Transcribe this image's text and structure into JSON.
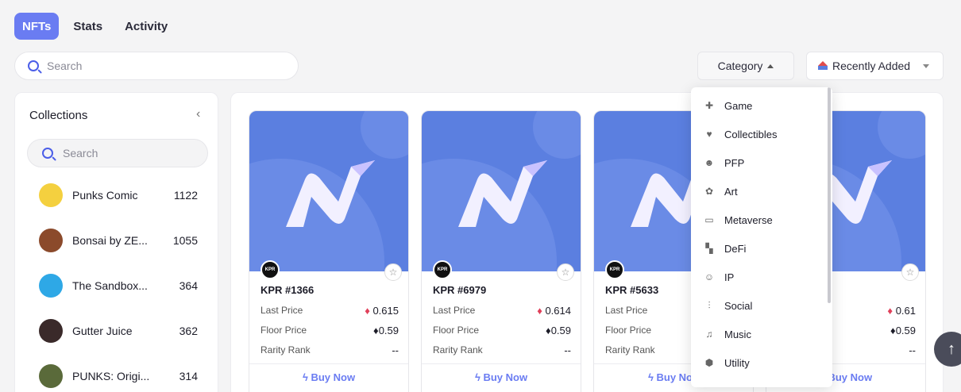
{
  "tabs": [
    {
      "label": "NFTs",
      "active": true
    },
    {
      "label": "Stats",
      "active": false
    },
    {
      "label": "Activity",
      "active": false
    }
  ],
  "search": {
    "placeholder": "Search"
  },
  "category_button": {
    "label": "Category"
  },
  "sort_button": {
    "label": "Recently Added"
  },
  "collections": {
    "title": "Collections",
    "search_placeholder": "Search",
    "items": [
      {
        "name": "Punks Comic",
        "count": "1122",
        "color": "#f4d03f"
      },
      {
        "name": "Bonsai by ZE...",
        "count": "1055",
        "color": "#8b4a2b"
      },
      {
        "name": "The Sandbox...",
        "count": "364",
        "color": "#2ea8e6"
      },
      {
        "name": "Gutter Juice",
        "count": "362",
        "color": "#3a2a2a"
      },
      {
        "name": "PUNKS: Origi...",
        "count": "314",
        "color": "#5a6a3a"
      }
    ]
  },
  "cards": [
    {
      "title": "KPR #1366",
      "last_price_label": "Last Price",
      "last_price": "0.615",
      "floor_price_label": "Floor Price",
      "floor_price": "0.59",
      "rarity_label": "Rarity Rank",
      "rarity": "--",
      "buy_label": "Buy Now",
      "badge": "KPR"
    },
    {
      "title": "KPR #6979",
      "last_price_label": "Last Price",
      "last_price": "0.614",
      "floor_price_label": "Floor Price",
      "floor_price": "0.59",
      "rarity_label": "Rarity Rank",
      "rarity": "--",
      "buy_label": "Buy Now",
      "badge": "KPR"
    },
    {
      "title": "KPR #5633",
      "last_price_label": "Last Price",
      "last_price": "",
      "floor_price_label": "Floor Price",
      "floor_price": "",
      "rarity_label": "Rarity Rank",
      "rarity": "",
      "buy_label": "Buy No",
      "badge": "KPR"
    },
    {
      "title": "",
      "last_price_label": "",
      "last_price": "0.61",
      "floor_price_label": "",
      "floor_price": "0.59",
      "rarity_label": "",
      "rarity": "--",
      "buy_label": "Buy Now",
      "badge": ""
    }
  ],
  "category_menu": [
    {
      "label": "Game",
      "icon": "game-icon",
      "glyph": "✚"
    },
    {
      "label": "Collectibles",
      "icon": "heart-icon",
      "glyph": "♥"
    },
    {
      "label": "PFP",
      "icon": "robot-icon",
      "glyph": "☻"
    },
    {
      "label": "Art",
      "icon": "palette-icon",
      "glyph": "✿"
    },
    {
      "label": "Metaverse",
      "icon": "vr-headset-icon",
      "glyph": "▭"
    },
    {
      "label": "DeFi",
      "icon": "defi-icon",
      "glyph": "▚"
    },
    {
      "label": "IP",
      "icon": "face-icon",
      "glyph": "☺"
    },
    {
      "label": "Social",
      "icon": "people-icon",
      "glyph": "⫶"
    },
    {
      "label": "Music",
      "icon": "music-icon",
      "glyph": "♫"
    },
    {
      "label": "Utility",
      "icon": "cube-icon",
      "glyph": "⬢"
    }
  ],
  "colors": {
    "accent": "#6a7cf2",
    "card_bg": "#5b7fe0",
    "eth_red": "#e0405a"
  }
}
